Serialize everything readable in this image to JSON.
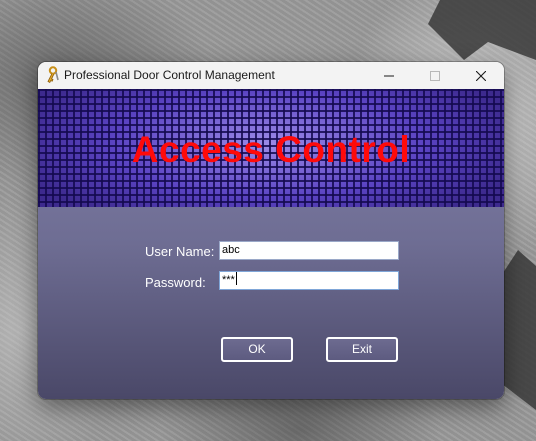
{
  "window": {
    "title": "Professional Door Control Management",
    "app_icon": "keys-icon",
    "controls": {
      "minimize_icon": "minimize-icon",
      "maximize_icon": "maximize-icon",
      "close_icon": "close-icon"
    }
  },
  "banner": {
    "title": "Access Control",
    "title_color": "#ff0a0a"
  },
  "form": {
    "username_label": "User Name:",
    "username_value": "abc",
    "password_label": "Password:",
    "password_value": "***"
  },
  "buttons": {
    "ok_label": "OK",
    "exit_label": "Exit"
  }
}
